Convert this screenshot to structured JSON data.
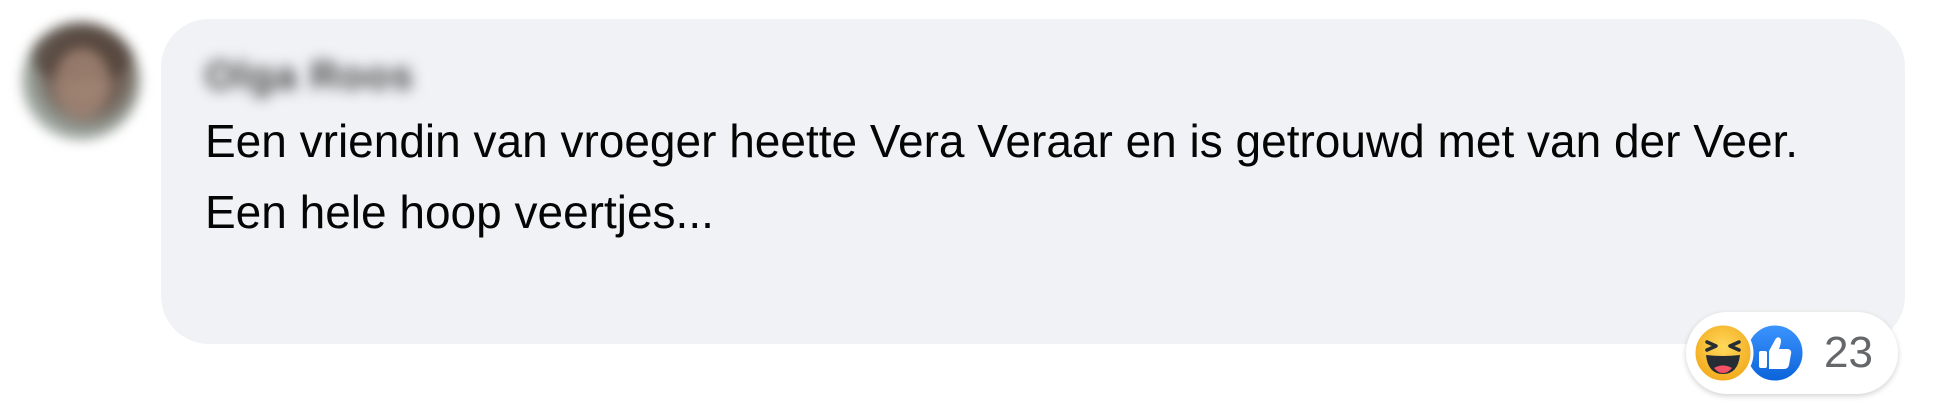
{
  "comment": {
    "author": "Olga Roos",
    "lines": [
      "Een vriendin van vroeger heette Vera Veraar en is getrouwd met van der Veer.",
      "Een hele hoop veertjes..."
    ]
  },
  "reactions": {
    "icons": [
      "haha-emoji-icon",
      "like-thumb-icon"
    ],
    "count": "23"
  },
  "colors": {
    "bubble": "#f0f2f5",
    "text": "#050505",
    "count": "#65676b",
    "like_blue": "#1b74e4",
    "haha_yellow": "#f7b125"
  }
}
